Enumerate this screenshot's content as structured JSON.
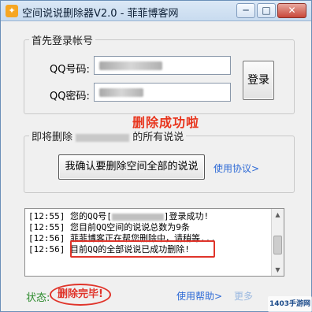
{
  "window": {
    "title": "空间说说删除器V2.0 - 菲菲博客网",
    "buttons": {
      "minimize": "─",
      "maximize": "□",
      "close": "✕"
    }
  },
  "login": {
    "group_title": "首先登录帐号",
    "qq_label": "QQ号码:",
    "password_label": "QQ密码:",
    "login_button": "登录"
  },
  "success_message": "删除成功啦",
  "delete_section": {
    "group_title_prefix": "即将删除",
    "group_title_suffix": "的所有说说",
    "confirm_button": "我确认要删除空间全部的说说",
    "protocol_link": "使用协议>"
  },
  "log": {
    "lines": [
      {
        "time": "[12:55]",
        "text_before": "您的QQ号[",
        "text_after": "]登录成功!"
      },
      {
        "time": "[12:55]",
        "text": "您目前QQ空间的说说总数为9条"
      },
      {
        "time": "[12:56]",
        "text": "菲菲博客正在帮您删除中，请稍等..."
      },
      {
        "time": "[12:56]",
        "text": "目前QQ的全部说说已成功删除!"
      }
    ]
  },
  "status": {
    "label": "状态:",
    "value": "删除完毕!"
  },
  "footer": {
    "help_link": "使用帮助>",
    "more_link": "更多"
  },
  "watermark": "1403手游网",
  "colors": {
    "success_red": "#e8341c",
    "link_blue": "#2f6bd6",
    "status_green": "#2c8a2c"
  }
}
